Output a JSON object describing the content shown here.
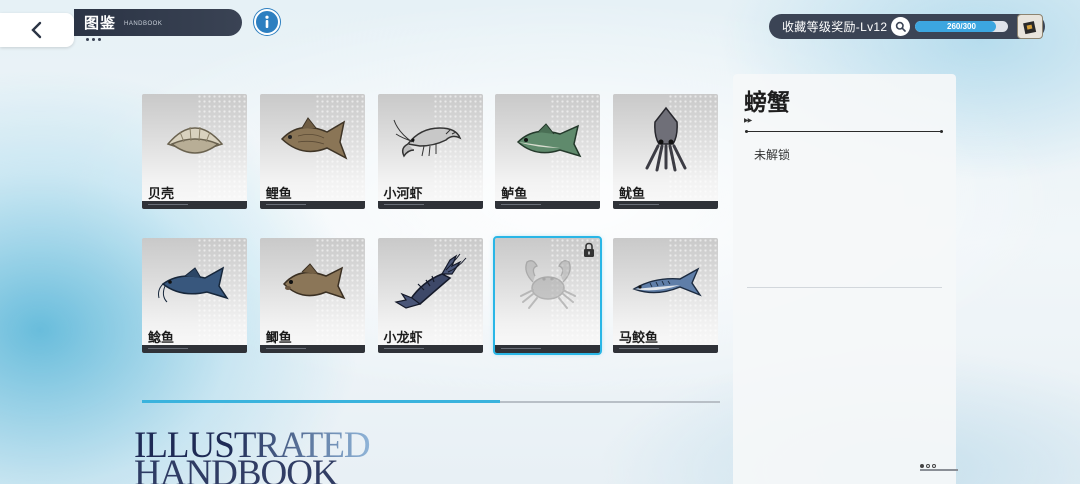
{
  "header": {
    "title": "图鉴",
    "subtitle": "HANDBOOK"
  },
  "reward": {
    "label": "收藏等级奖励-Lv12",
    "progress_text": "260/300",
    "progress_value": 260,
    "progress_max": 300
  },
  "items": [
    {
      "name": "贝壳",
      "icon": "shell-icon",
      "locked": false
    },
    {
      "name": "鲤鱼",
      "icon": "carp-icon",
      "locked": false
    },
    {
      "name": "小河虾",
      "icon": "shrimp-icon",
      "locked": false
    },
    {
      "name": "鲈鱼",
      "icon": "bass-icon",
      "locked": false
    },
    {
      "name": "鱿鱼",
      "icon": "squid-icon",
      "locked": false
    },
    {
      "name": "鲶鱼",
      "icon": "catfish-icon",
      "locked": false
    },
    {
      "name": "鲫鱼",
      "icon": "crucian-carp-icon",
      "locked": false
    },
    {
      "name": "小龙虾",
      "icon": "crayfish-icon",
      "locked": false
    },
    {
      "name": "",
      "icon": "crab-icon",
      "locked": true
    },
    {
      "name": "马鲛鱼",
      "icon": "mackerel-icon",
      "locked": false
    }
  ],
  "scroll": {
    "position": 0.62
  },
  "watermark": {
    "line1": "ILLUSTRATED",
    "line2": "HANDBOOK"
  },
  "detail": {
    "title": "螃蟹",
    "status": "未解锁"
  },
  "colors": {
    "accent": "#29b6e6",
    "header_bg": "#2b3445",
    "progress_fill": "#3ca6e0"
  }
}
